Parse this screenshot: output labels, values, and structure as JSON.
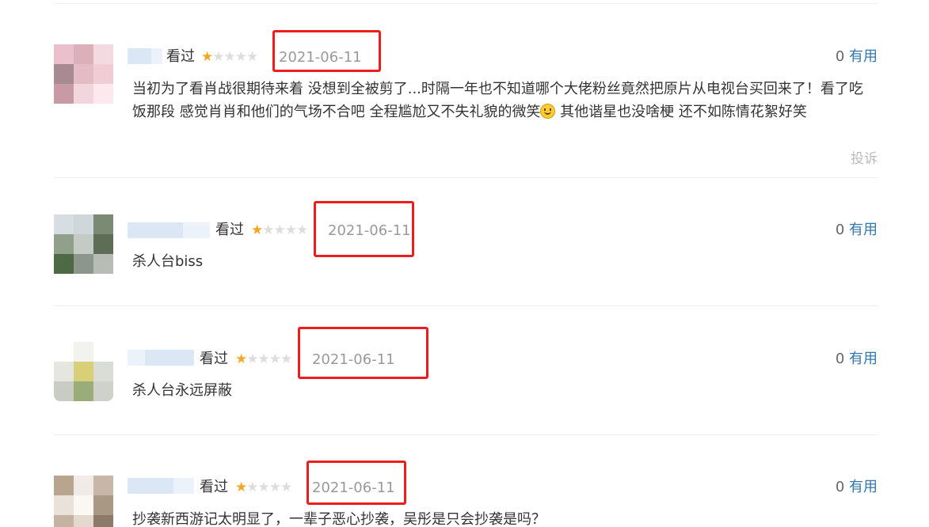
{
  "comments": [
    {
      "watched_label": "看过",
      "stars_on": "★",
      "stars_off": "★★★★",
      "rating": 1,
      "date": "2021-06-11",
      "votes": "0",
      "useful_label": "有用",
      "text_before_emoji": "当初为了看肖战很期待来着 没想到全被剪了...时隔一年也不知道哪个大佬粉丝竟然把原片从电视台买回来了！看了吃饭那段 感觉肖肖和他们的气场不合吧 全程尴尬又不失礼貌的微笑",
      "text_after_emoji": " 其他谐星也没啥梗 还不如陈情花絮好笑",
      "report_label": "投诉"
    },
    {
      "watched_label": "看过",
      "stars_on": "★",
      "stars_off": "★★★★",
      "rating": 1,
      "date": "2021-06-11",
      "votes": "0",
      "useful_label": "有用",
      "text": "杀人台biss"
    },
    {
      "watched_label": "看过",
      "stars_on": "★",
      "stars_off": "★★★★",
      "rating": 1,
      "date": "2021-06-11",
      "votes": "0",
      "useful_label": "有用",
      "text": "杀人台永远屏蔽"
    },
    {
      "watched_label": "看过",
      "stars_on": "★",
      "stars_off": "★★★★",
      "rating": 1,
      "date": "2021-06-11",
      "votes": "0",
      "useful_label": "有用",
      "text": "抄袭新西游记太明显了，一辈子恶心抄袭，吴彤是只会抄袭是吗？"
    }
  ],
  "colors": {
    "highlight_box": "#ee1c1c",
    "star_on": "#f5a623",
    "useful_link": "#3377aa"
  }
}
